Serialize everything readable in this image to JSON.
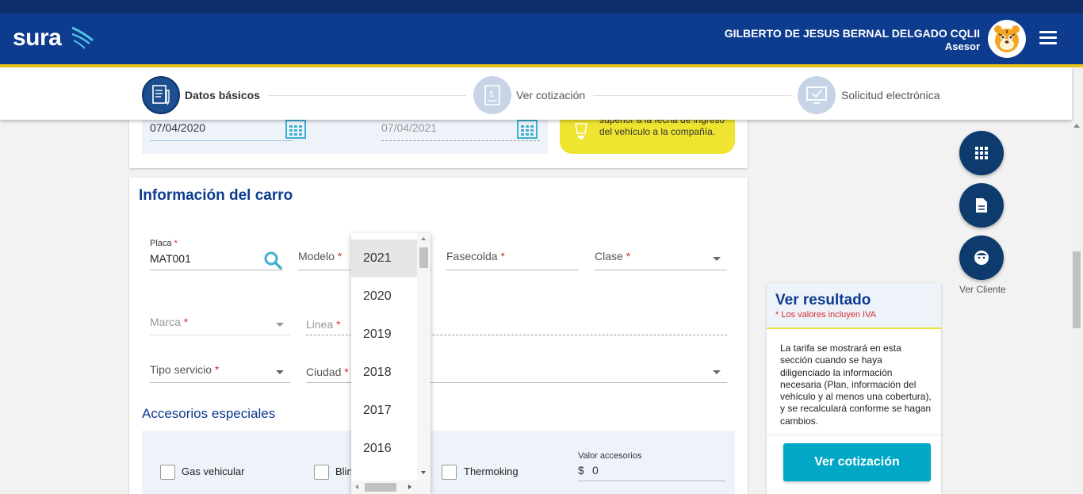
{
  "header": {
    "logo_text": "sura",
    "user_name": "GILBERTO DE JESUS BERNAL DELGADO CQLII",
    "user_role": "Asesor"
  },
  "stepper": {
    "steps": [
      {
        "label": "Datos básicos",
        "active": true
      },
      {
        "label": "Ver cotización",
        "active": false
      },
      {
        "label": "Solicitud electrónica",
        "active": false
      }
    ]
  },
  "dates": {
    "start_date": "07/04/2020",
    "end_date": "07/04/2021",
    "note": "superior a la fecha de ingreso del vehículo a la compañía."
  },
  "car_info": {
    "title": "Información del carro",
    "placa_label": "Placa",
    "placa_value": "MAT001",
    "modelo_label": "Modelo",
    "fasecolda_label": "Fasecolda",
    "clase_label": "Clase",
    "marca_label": "Marca",
    "linea_label": "Linea",
    "tipo_servicio_label": "Tipo servicio",
    "ciudad_label": "Ciudad",
    "required_mark": "*"
  },
  "modelo_dropdown": {
    "options": [
      "2021",
      "2020",
      "2019",
      "2018",
      "2017",
      "2016"
    ],
    "selected": "2021"
  },
  "accessories": {
    "title": "Accesorios especiales",
    "gas_label": "Gas vehicular",
    "blindaje_label": "Blin",
    "thermoking_label": "Thermoking",
    "valor_label": "Valor accesorios",
    "currency": "$",
    "valor_value": "0"
  },
  "result": {
    "title": "Ver resultado",
    "iva_note": "* Los valores incluyen IVA",
    "body": "La tarifa se mostrará en esta sección cuando se haya diligenciado la información necesaria (Plan, información del vehículo y al menos una cobertura), y se recalculará conforme se hagan cambios.",
    "button_label": "Ver cotización"
  },
  "side_actions": {
    "client_label": "Ver Cliente"
  },
  "colors": {
    "brand_blue": "#0d3b8e",
    "accent_yellow": "#e8c21b",
    "cta_teal": "#00a8c6"
  }
}
